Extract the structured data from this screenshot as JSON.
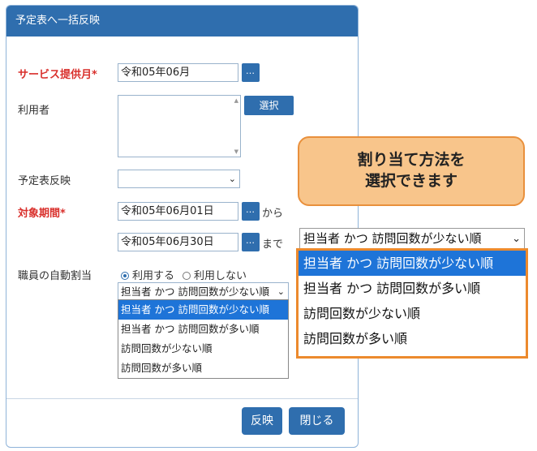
{
  "dialog": {
    "title": "予定表へ一括反映"
  },
  "form": {
    "service_month_label": "サービス提供月*",
    "service_month_value": "令和05年06月",
    "user_label": "利用者",
    "select_button": "選択",
    "schedule_reflect_label": "予定表反映",
    "schedule_reflect_value": "",
    "period_label": "対象期間*",
    "period_from_value": "令和05年06月01日",
    "from_suffix": "から",
    "period_to_value": "令和05年06月30日",
    "to_suffix": "まで",
    "dot_button": "…",
    "auto_assign_label": "職員の自動割当",
    "radio_use": "利用する",
    "radio_not_use": "利用しない",
    "radio_selected": "利用する",
    "assign_order_selected": "担当者 かつ 訪問回数が少ない順",
    "assign_order_options": [
      "担当者 かつ 訪問回数が少ない順",
      "担当者 かつ 訪問回数が多い順",
      "訪問回数が少ない順",
      "訪問回数が多い順"
    ]
  },
  "footer": {
    "apply_button": "反映",
    "close_button": "閉じる"
  },
  "callout": {
    "line1": "割り当て方法を",
    "line2": "選択できます"
  },
  "zoom": {
    "selected": "担当者 かつ 訪問回数が少ない順",
    "options": [
      "担当者 かつ 訪問回数が少ない順",
      "担当者 かつ 訪問回数が多い順",
      "訪問回数が少ない順",
      "訪問回数が多い順"
    ]
  },
  "colors": {
    "primary": "#2f6eae",
    "required": "#d9302c",
    "highlight": "#1e74d8",
    "callout_fill": "#f8c58b",
    "callout_border": "#ec8a2d"
  }
}
